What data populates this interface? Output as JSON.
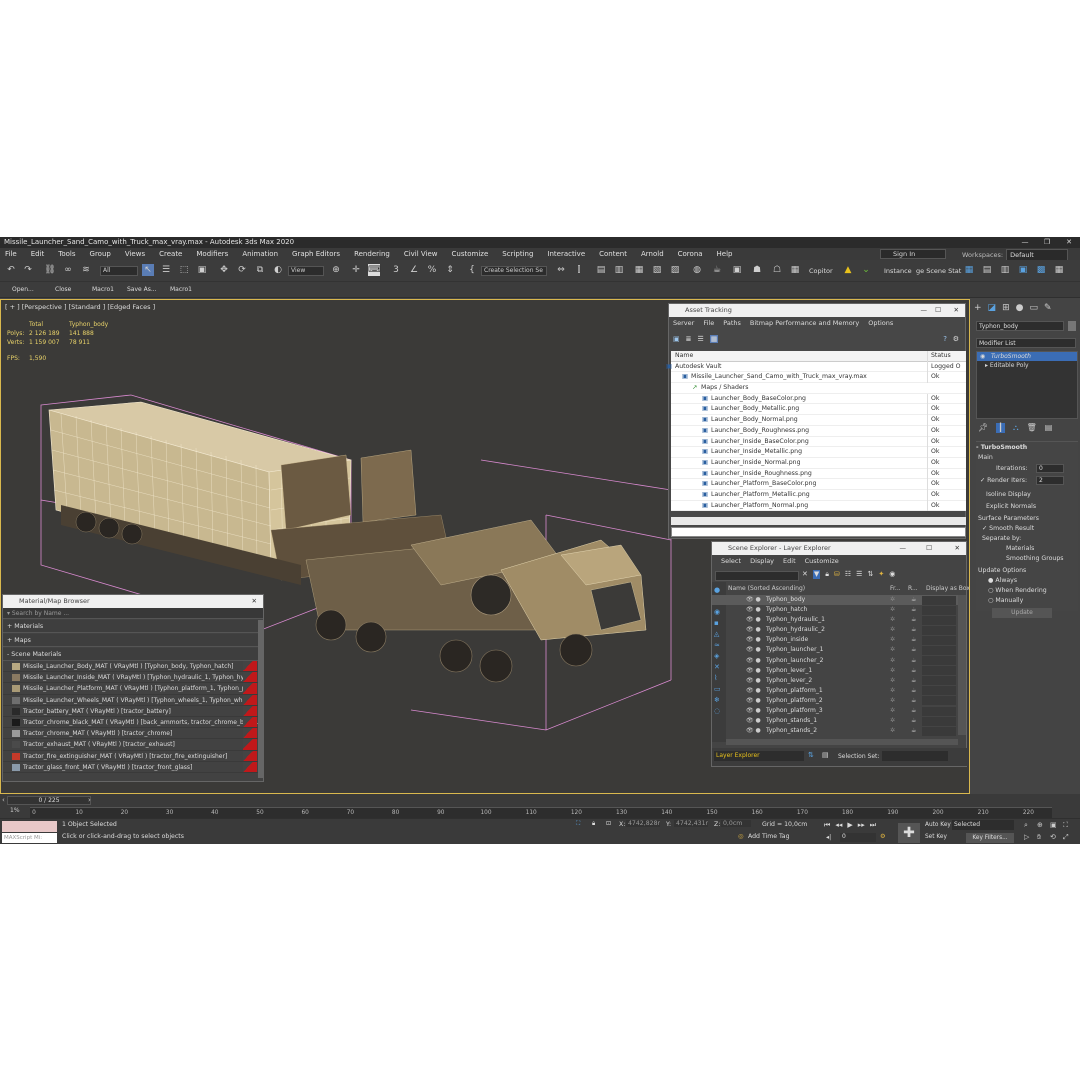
{
  "window": {
    "title": "Missile_Launcher_Sand_Camo_with_Truck_max_vray.max - Autodesk 3ds Max 2020"
  },
  "menu": [
    "File",
    "Edit",
    "Tools",
    "Group",
    "Views",
    "Create",
    "Modifiers",
    "Animation",
    "Graph Editors",
    "Rendering",
    "Civil View",
    "Customize",
    "Scripting",
    "Interactive",
    "Content",
    "Arnold",
    "Corona",
    "Help"
  ],
  "account": {
    "sign_in": "Sign In",
    "workspaces_label": "Workspaces:",
    "workspace": "Default"
  },
  "toolbar": {
    "filter": "All",
    "view": "View",
    "selection_set": "Create Selection Se",
    "copitor": "Copitor",
    "instance": "Instance",
    "scene_stat": "ge Scene Stat"
  },
  "ribbon": [
    "Open...",
    "Close",
    "Save As...",
    "Macro1",
    "Macro1"
  ],
  "viewport": {
    "label": "[ + ] [Perspective ] [Standard ] [Edged Faces ]",
    "stats": {
      "col_total": "Total",
      "col_obj": "Typhon_body",
      "polys_label": "Polys:",
      "polys_total": "2 126 189",
      "polys_obj": "141 888",
      "verts_label": "Verts:",
      "verts_total": "1 159 007",
      "verts_obj": "78 911",
      "fps_label": "FPS:",
      "fps": "1,590"
    }
  },
  "asset_tracking": {
    "title": "Asset Tracking",
    "menu": [
      "Server",
      "File",
      "Paths",
      "Bitmap Performance and Memory",
      "Options"
    ],
    "col_name": "Name",
    "col_status": "Status",
    "rows": [
      {
        "name": "Autodesk Vault",
        "status": "Logged O"
      },
      {
        "name": "Missile_Launcher_Sand_Camo_with_Truck_max_vray.max",
        "status": "Ok"
      },
      {
        "name": "Maps / Shaders",
        "status": ""
      },
      {
        "name": "Launcher_Body_BaseColor.png",
        "status": "Ok"
      },
      {
        "name": "Launcher_Body_Metallic.png",
        "status": "Ok"
      },
      {
        "name": "Launcher_Body_Normal.png",
        "status": "Ok"
      },
      {
        "name": "Launcher_Body_Roughness.png",
        "status": "Ok"
      },
      {
        "name": "Launcher_Inside_BaseColor.png",
        "status": "Ok"
      },
      {
        "name": "Launcher_Inside_Metallic.png",
        "status": "Ok"
      },
      {
        "name": "Launcher_Inside_Normal.png",
        "status": "Ok"
      },
      {
        "name": "Launcher_Inside_Roughness.png",
        "status": "Ok"
      },
      {
        "name": "Launcher_Platform_BaseColor.png",
        "status": "Ok"
      },
      {
        "name": "Launcher_Platform_Metallic.png",
        "status": "Ok"
      },
      {
        "name": "Launcher_Platform_Normal.png",
        "status": "Ok"
      }
    ]
  },
  "scene_explorer": {
    "title": "Scene Explorer - Layer Explorer",
    "menu": [
      "Select",
      "Display",
      "Edit",
      "Customize"
    ],
    "col_name": "Name (Sorted Ascending)",
    "col_fr": "Fr...",
    "col_r": "R...",
    "col_box": "Display as Box",
    "rows": [
      "Typhon_body",
      "Typhon_hatch",
      "Typhon_hydraulic_1",
      "Typhon_hydraulic_2",
      "Typhon_inside",
      "Typhon_launcher_1",
      "Typhon_launcher_2",
      "Typhon_lever_1",
      "Typhon_lever_2",
      "Typhon_platform_1",
      "Typhon_platform_2",
      "Typhon_platform_3",
      "Typhon_stands_1",
      "Typhon_stands_2"
    ],
    "footer_layer": "Layer Explorer",
    "footer_selset": "Selection Set:"
  },
  "material_browser": {
    "title": "Material/Map Browser",
    "search_placeholder": "Search by Name ...",
    "cat_materials": "+ Materials",
    "cat_maps": "+ Maps",
    "cat_scene": "- Scene Materials",
    "items": [
      "Missile_Launcher_Body_MAT ( VRayMtl ) [Typhon_body, Typhon_hatch]",
      "Missile_Launcher_Inside_MAT ( VRayMtl ) [Typhon_hydraulic_1, Typhon_hydr...",
      "Missile_Launcher_Platform_MAT ( VRayMtl ) [Typhon_platform_1, Typhon_pla...",
      "Missile_Launcher_Wheels_MAT ( VRayMtl ) [Typhon_wheels_1, Typhon_wheel...",
      "Tractor_battery_MAT ( VRayMtl ) [tractor_battery]",
      "Tractor_chrome_black_MAT ( VRayMtl ) [back_ammorts, tractor_chrome_blac...",
      "Tractor_chrome_MAT ( VRayMtl ) [tractor_chrome]",
      "Tractor_exhaust_MAT ( VRayMtl ) [tractor_exhaust]",
      "Tractor_fire_extinguisher_MAT ( VRayMtl ) [tractor_fire_extinguisher]",
      "Tractor_glass_front_MAT ( VRayMtl ) [tractor_front_glass]"
    ]
  },
  "command_panel": {
    "object_name": "Typhon_body",
    "modifier_list": "Modifier List",
    "stack": [
      "TurboSmooth",
      "Editable Poly"
    ],
    "rollout_title": "TurboSmooth",
    "main": "Main",
    "iterations_label": "Iterations:",
    "iterations": "0",
    "render_iters_label": "Render Iters:",
    "render_iters": "2",
    "isoline": "Isoline Display",
    "explicit": "Explicit Normals",
    "surface": "Surface Parameters",
    "smooth_result": "Smooth Result",
    "separate_by": "Separate by:",
    "materials": "Materials",
    "smoothing_groups": "Smoothing Groups",
    "update_options": "Update Options",
    "always": "Always",
    "when_rendering": "When Rendering",
    "manually": "Manually",
    "update": "Update"
  },
  "timeline": {
    "frame": "0 / 225",
    "ticks": [
      "0",
      "10",
      "20",
      "30",
      "40",
      "50",
      "60",
      "70",
      "80",
      "90",
      "100",
      "110",
      "120",
      "130",
      "140",
      "150",
      "160",
      "170",
      "180",
      "190",
      "200",
      "210",
      "220"
    ]
  },
  "status": {
    "maxscript": "MAXScript Mi:",
    "selected": "1 Object Selected",
    "prompt": "Click or click-and-drag to select objects",
    "x_label": "X:",
    "x": "4742,828m",
    "y_label": "Y:",
    "y": "4742,431m",
    "z_label": "Z:",
    "z": "0,0cm",
    "grid": "Grid = 10,0cm",
    "add_time_tag": "Add Time Tag",
    "auto_key": "Auto Key",
    "selected_dd": "Selected",
    "set_key": "Set Key",
    "key_filters": "Key Filters...",
    "frame_field": "0"
  },
  "colors": {
    "selection_pink": "#d98ad0",
    "mesh": "#e8d9b8",
    "accent_blue": "#3b6db5"
  }
}
